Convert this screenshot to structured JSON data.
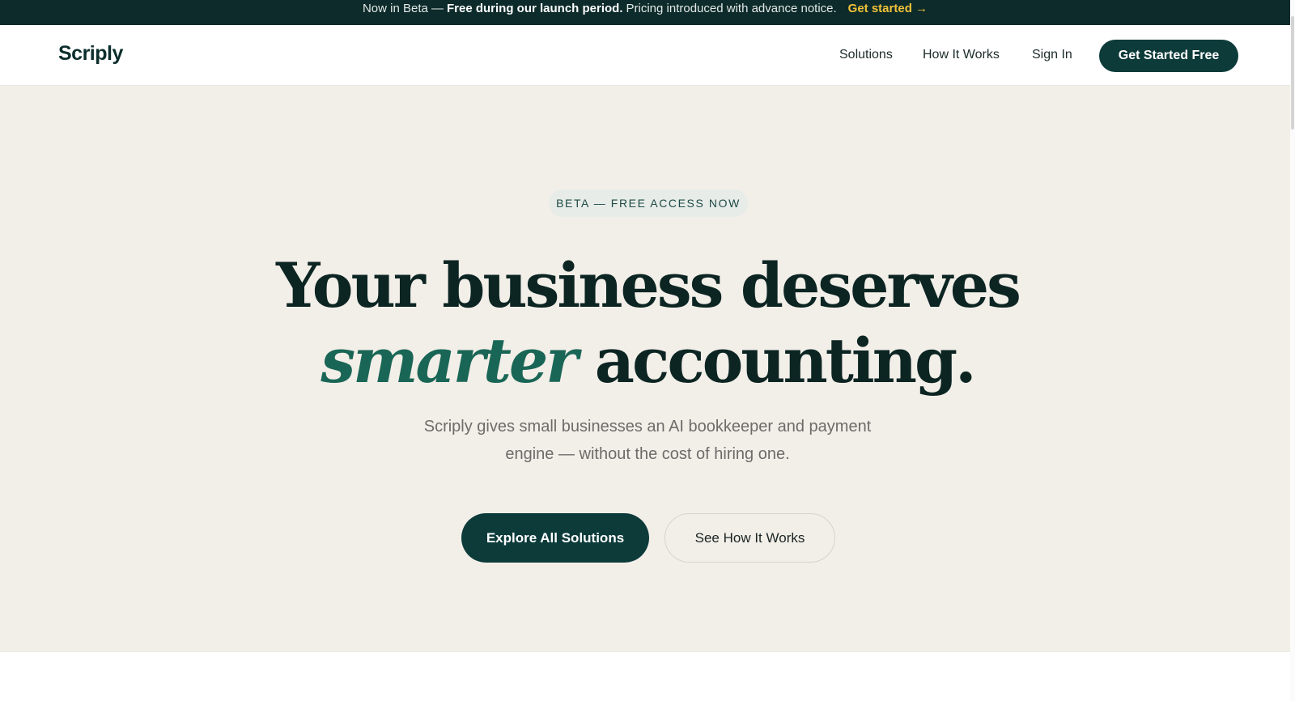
{
  "announcement": {
    "prefix": "Now in Beta —",
    "bold": "Free during our launch period.",
    "suffix": "Pricing introduced with advance notice.",
    "cta": "Get started →"
  },
  "nav": {
    "logo": "Scriply",
    "links": [
      "Solutions",
      "How It Works",
      "Sign In"
    ],
    "cta": "Get Started Free"
  },
  "hero": {
    "badge": "BETA — FREE ACCESS NOW",
    "headline_line1": "Your business deserves",
    "headline_accent": "smarter",
    "headline_line2_rest": " accounting.",
    "subtitle": "Scriply gives small businesses an AI bookkeeper and payment engine — without the cost of hiring one.",
    "primary_button": "Explore All Solutions",
    "secondary_button": "See How It Works"
  },
  "colors": {
    "brand_dark": "#0c3b3a",
    "accent_green": "#1a6656",
    "announce_cta": "#f2c23a",
    "hero_bg": "#f2eee8"
  }
}
